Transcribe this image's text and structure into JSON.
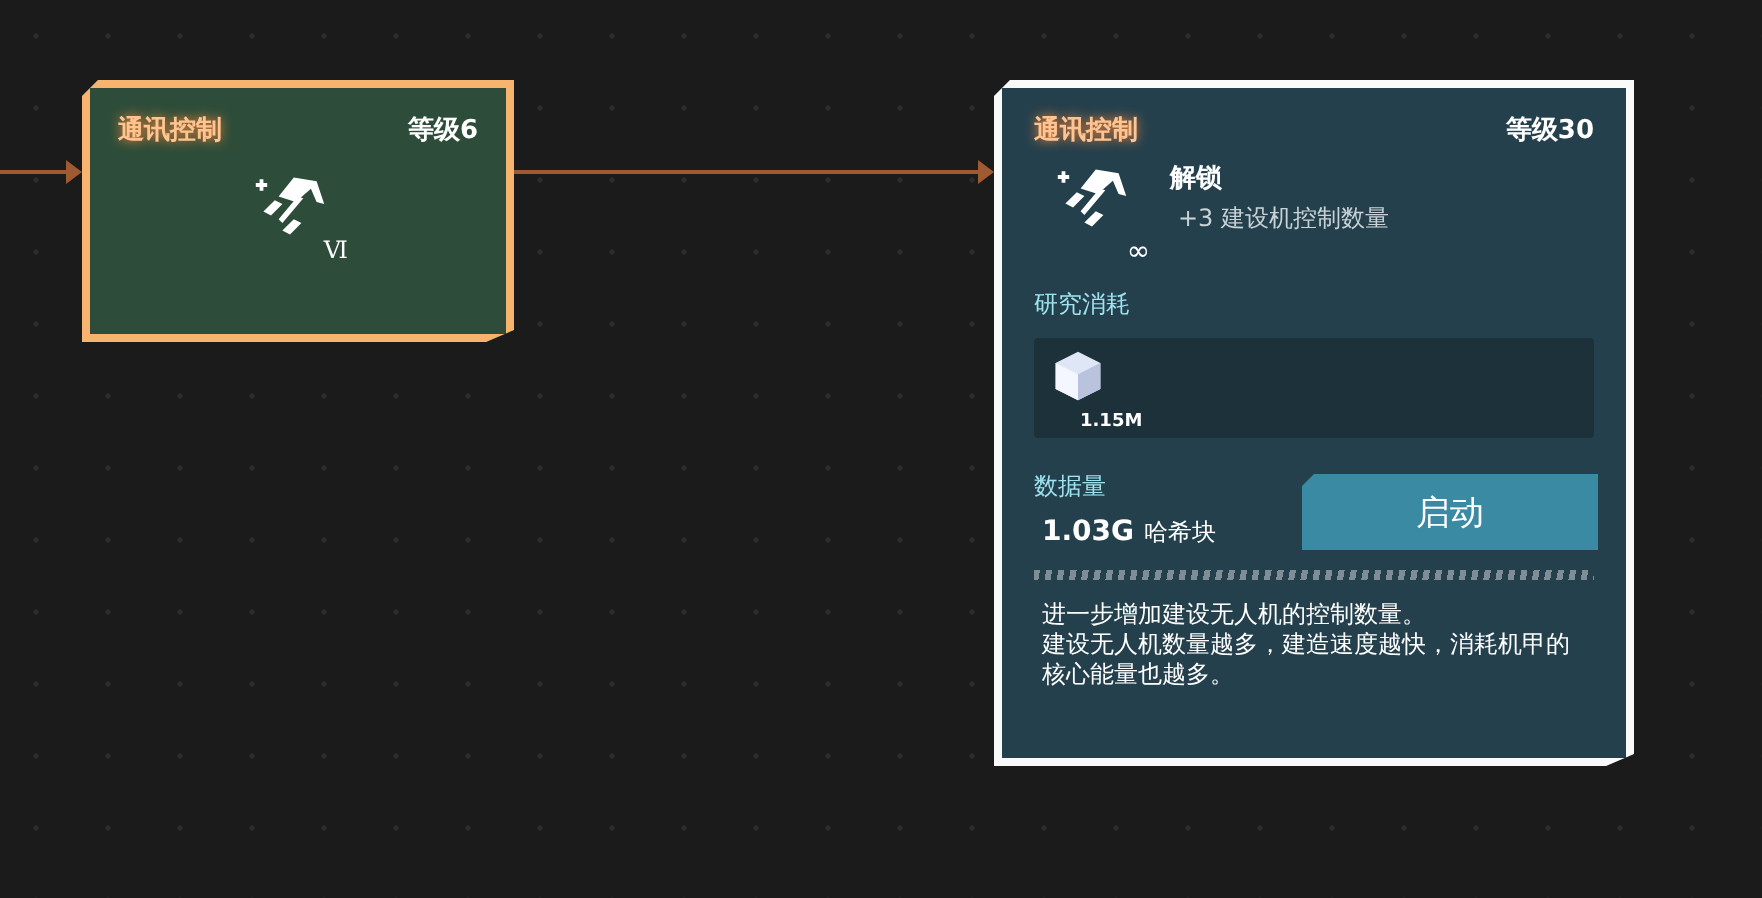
{
  "nodes": [
    {
      "kind": "compact",
      "selected": false,
      "title": "通讯控制",
      "level_label": "等级6",
      "tier": "Ⅵ"
    },
    {
      "kind": "detail",
      "selected": true,
      "title": "通讯控制",
      "level_label": "等级30",
      "tier": "∞",
      "effect_title": "解锁",
      "effect_text": "+3 建设机控制数量",
      "cost_label": "研究消耗",
      "costs": [
        {
          "amount": "1.15M"
        }
      ],
      "data_label": "数据量",
      "data_value": "1.03G",
      "data_unit": "哈希块",
      "button": "启动",
      "description": [
        "进一步增加建设无人机的控制数量。",
        "建设无人机数量越多，建造速度越快，消耗机甲的核心能量也越多。"
      ]
    }
  ]
}
